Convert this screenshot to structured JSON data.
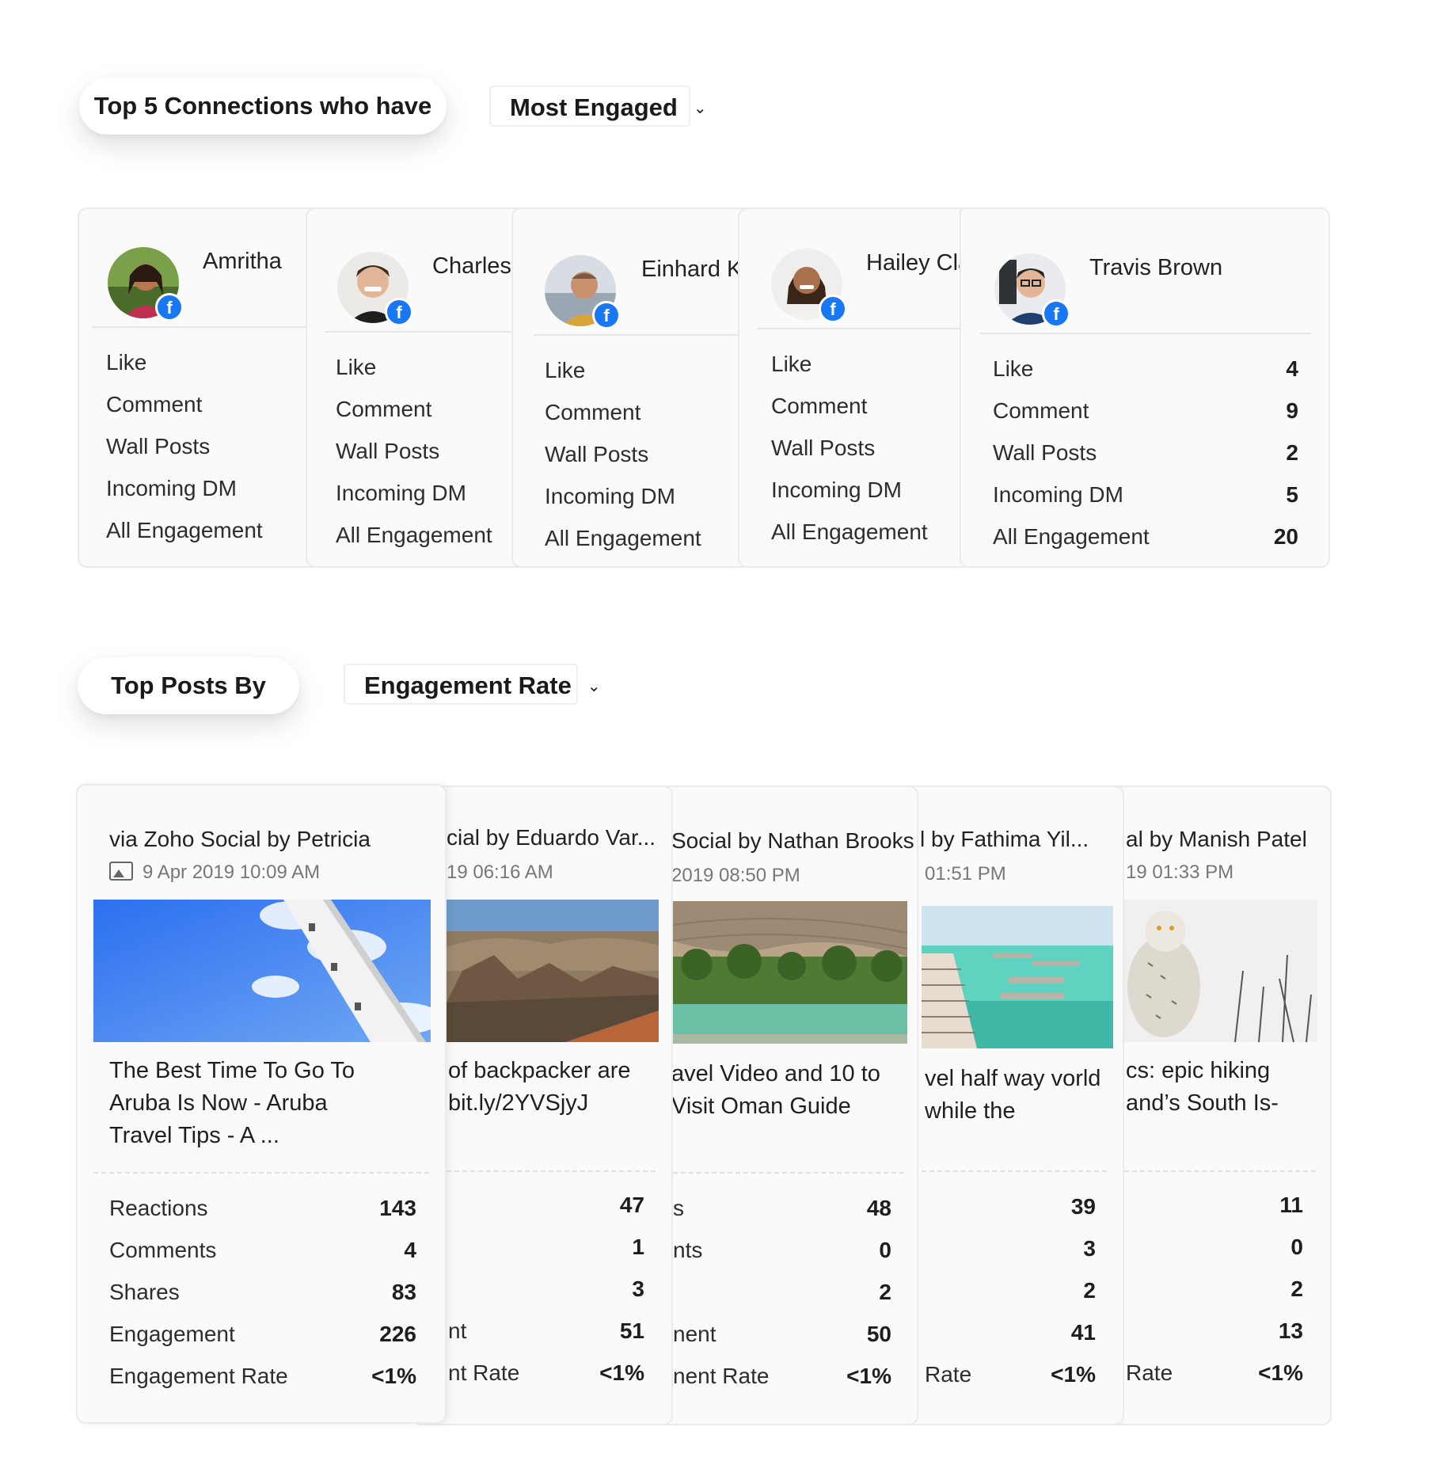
{
  "connections": {
    "header_label": "Top 5 Connections who have",
    "filter_value": "Most Engaged",
    "stat_labels": [
      "Like",
      "Comment",
      "Wall Posts",
      "Incoming DM",
      "All Engagement"
    ],
    "cards": [
      {
        "name": "Amritha",
        "values": []
      },
      {
        "name": "Charles",
        "values": []
      },
      {
        "name": "Einhard K",
        "values": []
      },
      {
        "name": "Hailey Cla",
        "values": []
      },
      {
        "name": "Travis Brown",
        "values": [
          "4",
          "9",
          "2",
          "5",
          "20"
        ]
      }
    ]
  },
  "posts": {
    "header_label": "Top Posts By",
    "filter_value": "Engagement Rate",
    "cards": [
      {
        "by": "via Zoho Social by Petricia",
        "date": "9 Apr 2019 10:09 AM",
        "title": "The Best Time To Go To Aruba Is Now - Aruba Travel Tips - A ...",
        "labels": [
          "Reactions",
          "Comments",
          "Shares",
          "Engagement",
          "Engagement Rate"
        ],
        "values": [
          "143",
          "4",
          "83",
          "226",
          "<1%"
        ]
      },
      {
        "by": "cial by Eduardo Var...",
        "date": "19 06:16 AM",
        "title": "of backpacker are bit.ly/2YVSjyJ",
        "labels": [
          "",
          "",
          "",
          "nt",
          "nt Rate"
        ],
        "values": [
          "47",
          "1",
          "3",
          "51",
          "<1%"
        ]
      },
      {
        "by": "Social by Nathan Brooks",
        "date": "2019 08:50 PM",
        "title": "avel Video and 10 to Visit Oman Guide",
        "labels": [
          "s",
          "nts",
          "",
          "nent",
          "nent Rate"
        ],
        "values": [
          "48",
          "0",
          "2",
          "50",
          "<1%"
        ]
      },
      {
        "by": "l by Fathima Yil...",
        "date": "01:51 PM",
        "title": "vel half way vorld while the",
        "labels": [
          "",
          "",
          "",
          "",
          "Rate"
        ],
        "values": [
          "39",
          "3",
          "2",
          "41",
          "<1%"
        ]
      },
      {
        "by": "al by Manish Patel",
        "date": "19 01:33 PM",
        "title": "cs: epic hiking and’s South Is-",
        "labels": [
          "",
          "",
          "",
          "",
          "Rate"
        ],
        "values": [
          "11",
          "0",
          "2",
          "13",
          "<1%"
        ]
      }
    ]
  }
}
